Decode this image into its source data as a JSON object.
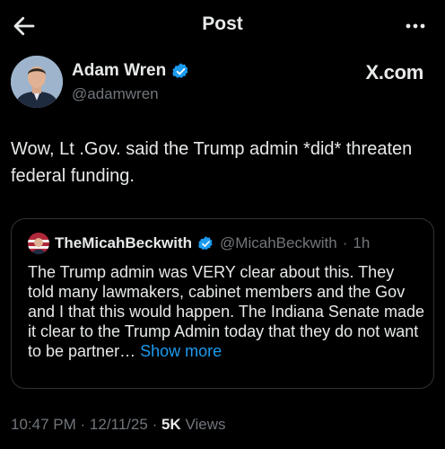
{
  "header": {
    "title": "Post"
  },
  "author": {
    "display_name": "Adam Wren",
    "handle": "@adamwren",
    "source_label": "X.com"
  },
  "post": {
    "text": "Wow, Lt .Gov. said the Trump admin *did* threaten federal funding."
  },
  "quote": {
    "display_name": "TheMicahBeckwith",
    "handle": "@MicahBeckwith",
    "separator": "·",
    "time": "1h",
    "text": "The Trump admin was VERY clear about this. They told many lawmakers, cabinet members and the Gov and I that this would happen. The Indiana Senate made it clear to the Trump Admin today that they do not want to be partner…",
    "show_more_label": "Show more"
  },
  "meta": {
    "time": "10:47 PM",
    "sep1": "·",
    "date": "12/11/25",
    "sep2": "·",
    "views_count": "5K",
    "views_label": "Views"
  },
  "colors": {
    "background": "#000000",
    "text": "#e7e9ea",
    "secondary": "#71767b",
    "accent": "#1d9bf0",
    "border": "#2f3336"
  },
  "icons": [
    "back-arrow-icon",
    "more-options-icon",
    "verified-badge-icon"
  ]
}
